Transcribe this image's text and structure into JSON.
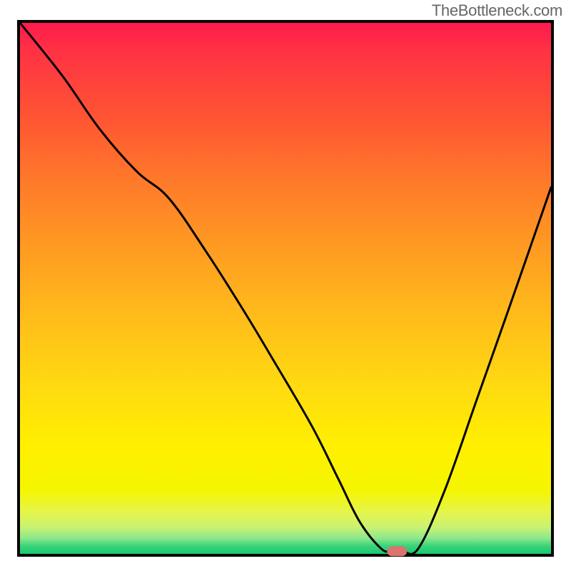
{
  "watermark": "TheBottleneck.com",
  "chart_data": {
    "type": "line",
    "title": "",
    "xlabel": "",
    "ylabel": "",
    "xlim": [
      0,
      100
    ],
    "ylim": [
      0,
      100
    ],
    "grid": false,
    "legend": false,
    "series": [
      {
        "name": "bottleneck-curve",
        "x": [
          0,
          8,
          15,
          22,
          28,
          35,
          42,
          48,
          55,
          60,
          64,
          68,
          70,
          72,
          75,
          80,
          86,
          92,
          100
        ],
        "y": [
          100,
          90,
          80,
          72,
          67,
          57,
          46,
          36,
          24,
          14,
          6,
          1,
          0.5,
          0.5,
          1,
          12,
          29,
          46,
          69
        ]
      }
    ],
    "marker": {
      "x": 71,
      "y": 0.5,
      "shape": "pill",
      "color": "#d9746e"
    },
    "background_gradient": {
      "direction": "vertical",
      "stops": [
        {
          "pos": 0.0,
          "color": "#ff1a4d"
        },
        {
          "pos": 0.3,
          "color": "#ff7a2a"
        },
        {
          "pos": 0.68,
          "color": "#ffd911"
        },
        {
          "pos": 0.88,
          "color": "#f5f500"
        },
        {
          "pos": 0.97,
          "color": "#8fe88c"
        },
        {
          "pos": 1.0,
          "color": "#18c96e"
        }
      ]
    }
  }
}
